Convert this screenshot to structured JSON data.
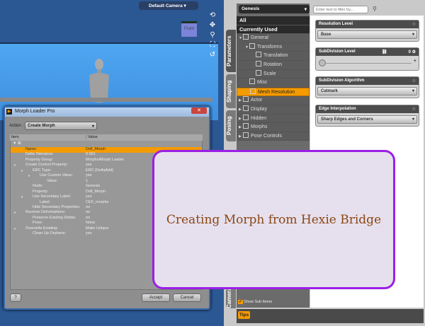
{
  "viewport": {
    "camera": "Default Camera",
    "cube_label": "Front"
  },
  "right_panel": {
    "tabs": [
      "Parameters",
      "Shaping",
      "Posing",
      "Cameras"
    ],
    "node_select": "Genesis",
    "filter_placeholder": "Enter text to filter by...",
    "tree": [
      {
        "label": "All",
        "type": "top"
      },
      {
        "label": "Currently Used",
        "type": "top"
      },
      {
        "label": "General",
        "indent": 0,
        "arrow": "▼"
      },
      {
        "label": "Transforms",
        "indent": 1,
        "arrow": "▼"
      },
      {
        "label": "Translation",
        "indent": 2,
        "arrow": ""
      },
      {
        "label": "Rotation",
        "indent": 2,
        "arrow": ""
      },
      {
        "label": "Scale",
        "indent": 2,
        "arrow": ""
      },
      {
        "label": "Misc",
        "indent": 1,
        "arrow": ""
      },
      {
        "label": "Mesh Resolution",
        "indent": 1,
        "arrow": "",
        "selected": true
      },
      {
        "label": "Actor",
        "indent": 0,
        "arrow": "▶"
      },
      {
        "label": "Display",
        "indent": 0,
        "arrow": "▶"
      },
      {
        "label": "Hidden",
        "indent": 0,
        "arrow": "▶"
      },
      {
        "label": "Morphs",
        "indent": 0,
        "arrow": "▶"
      },
      {
        "label": "Pose Controls",
        "indent": 0,
        "arrow": "▶"
      }
    ],
    "properties": [
      {
        "title": "Resolution Level",
        "value": "Base",
        "kind": "dropdown"
      },
      {
        "title": "SubDivision Level",
        "value": "0",
        "kind": "slider"
      },
      {
        "title": "SubDivision Algorithm",
        "value": "Catmark",
        "kind": "dropdown"
      },
      {
        "title": "Edge Interpolation",
        "value": "Sharp Edges and Corners",
        "kind": "dropdown"
      }
    ],
    "show_sub_items": "Show Sub Items",
    "tips": "Tips"
  },
  "dialog": {
    "title": "Morph Loader Pro",
    "action_label": "Action :",
    "action_value": "Create Morph",
    "columns": [
      "Item",
      "Value"
    ],
    "rows": [
      {
        "item": "Name:",
        "value": "Doll_Morph",
        "indent": 0,
        "selected": true
      },
      {
        "item": "Delta Tolerance:",
        "value": "0.001",
        "indent": 0
      },
      {
        "item": "Property Group:",
        "value": "Morphs/Morph Loader",
        "indent": 0
      },
      {
        "item": "Create Control Property:",
        "value": "yes",
        "indent": 0,
        "arrow": true
      },
      {
        "item": "ERC Type:",
        "value": "ERC [DeltaAdd]",
        "indent": 1,
        "arrow": true
      },
      {
        "item": "Use Custom Value:",
        "value": "yes",
        "indent": 2,
        "arrow": true
      },
      {
        "item": "Value:",
        "value": "1",
        "indent": 3
      },
      {
        "item": "Node:",
        "value": "Genesis",
        "indent": 1
      },
      {
        "item": "Property:",
        "value": "Doll_Morph",
        "indent": 1
      },
      {
        "item": "Use Secondary Label:",
        "value": "yes",
        "indent": 1,
        "arrow": true
      },
      {
        "item": "Label:",
        "value": "CEF_morphs",
        "indent": 2
      },
      {
        "item": "Hide Secondary Properties:",
        "value": "no",
        "indent": 1
      },
      {
        "item": "Reverse Deformations:",
        "value": "no",
        "indent": 0,
        "arrow": true
      },
      {
        "item": "Preserve Existing Deltas:",
        "value": "no",
        "indent": 1
      },
      {
        "item": "Pose:",
        "value": "None",
        "indent": 1
      },
      {
        "item": "Overwrite Existing:",
        "value": "Make Unique",
        "indent": 0,
        "arrow": true
      },
      {
        "item": "Clean Up Orphans:",
        "value": "yes",
        "indent": 1
      }
    ],
    "help": "?",
    "accept": "Accept",
    "cancel": "Cancel"
  },
  "overlay": {
    "caption": "Creating Morph from Hexie Bridge",
    "border_color": "#9b1fe6",
    "text_color": "#8b4513"
  }
}
